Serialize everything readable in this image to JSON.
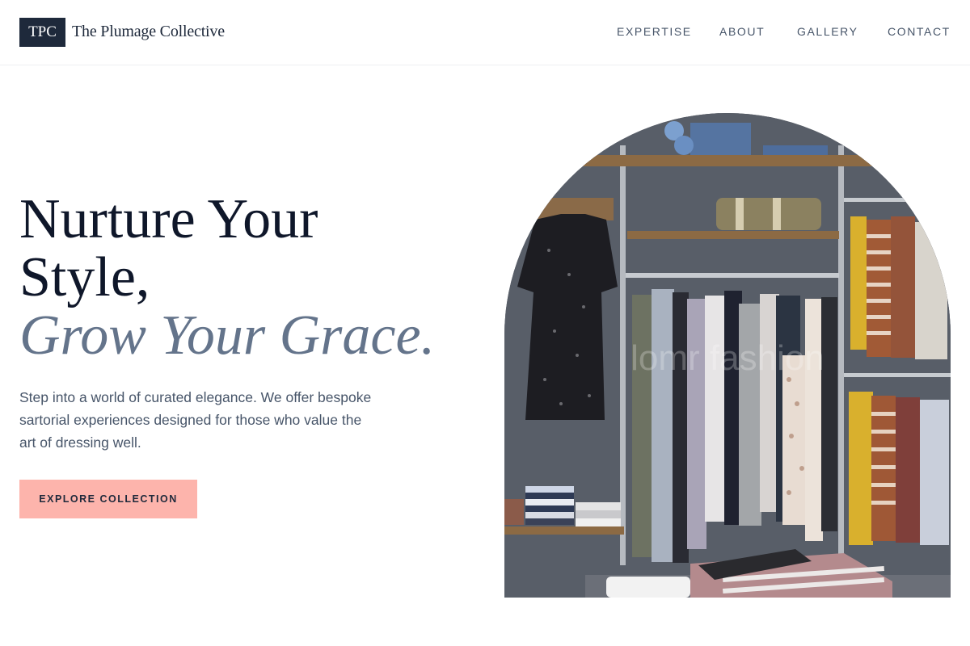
{
  "brand": {
    "logo_text": "TPC",
    "name": "The Plumage Collective"
  },
  "nav": {
    "items": [
      {
        "label": "EXPERTISE"
      },
      {
        "label": "ABOUT"
      },
      {
        "label": "GALLERY"
      },
      {
        "label": "CONTACT"
      }
    ]
  },
  "hero": {
    "headline_line1": "Nurture Your",
    "headline_line2": "Style,",
    "headline_accent": "Grow Your Grace.",
    "description": "Step into a world of curated elegance. We offer bespoke sartorial experiences designed for those who value the art of dressing well.",
    "cta_label": "EXPLORE COLLECTION",
    "image_subject": "boutique clothing rack with dresses, striped shirts, folded garments and a canvas bag on wooden shelves",
    "image_watermark": "lomr fashion"
  },
  "colors": {
    "primary_dark": "#1e293b",
    "accent_text": "#64748b",
    "cta_background": "#fdb4ac",
    "body_text": "#475569"
  }
}
